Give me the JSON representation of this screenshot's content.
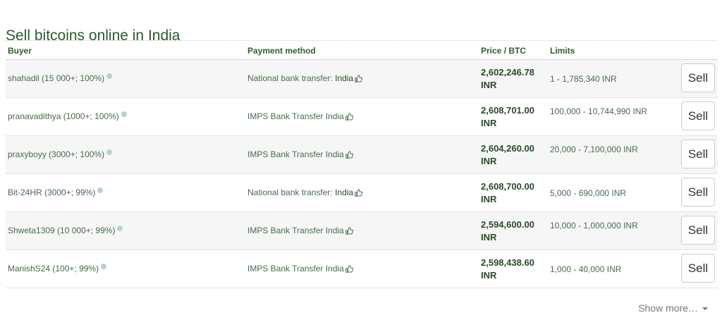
{
  "page": {
    "title": "Sell bitcoins online in India"
  },
  "table": {
    "headers": {
      "buyer": "Buyer",
      "payment": "Payment method",
      "price": "Price / BTC",
      "limits": "Limits"
    },
    "rows": [
      {
        "buyer": "shahadil (15 000+; 100%)",
        "payment": "National bank transfer: ",
        "country": "India",
        "price": "2,602,246.78",
        "currency": "INR",
        "limits": "1 - 1,785,340 INR",
        "sell": "Sell"
      },
      {
        "buyer": "pranavadithya (1000+; 100%)",
        "payment": "IMPS Bank Transfer India",
        "country": "",
        "price": "2,608,701.00",
        "currency": "INR",
        "limits": "100,000 - 10,744,990 INR",
        "sell": "Sell"
      },
      {
        "buyer": "praxyboyy (3000+; 100%)",
        "payment": "IMPS Bank Transfer India",
        "country": "",
        "price": "2,604,260.00",
        "currency": "INR",
        "limits": "20,000 - 7,100,000 INR",
        "sell": "Sell"
      },
      {
        "buyer": "Bit-24HR (3000+; 99%)",
        "payment": "National bank transfer: ",
        "country": "India",
        "price": "2,608,700.00",
        "currency": "INR",
        "limits": "5,000 - 690,000 INR",
        "sell": "Sell"
      },
      {
        "buyer": "Shweta1309 (10 000+; 99%)",
        "payment": "IMPS Bank Transfer India",
        "country": "",
        "price": "2,594,600.00",
        "currency": "INR",
        "limits": "10,000 - 1,000,000 INR",
        "sell": "Sell"
      },
      {
        "buyer": "ManishS24 (100+; 99%)",
        "payment": "IMPS Bank Transfer India",
        "country": "",
        "price": "2,598,438.60",
        "currency": "INR",
        "limits": "1,000 - 40,000 INR",
        "sell": "Sell"
      }
    ]
  },
  "footer": {
    "show_more": "Show more…"
  },
  "icons": {
    "status": "online-status-dot-icon",
    "feedback": "thumbs-up-icon",
    "dropdown": "caret-down-icon"
  },
  "colors": {
    "title": "#2a5a2a",
    "dot": "#b9d3c6",
    "row_alt": "#f6f6f6"
  }
}
